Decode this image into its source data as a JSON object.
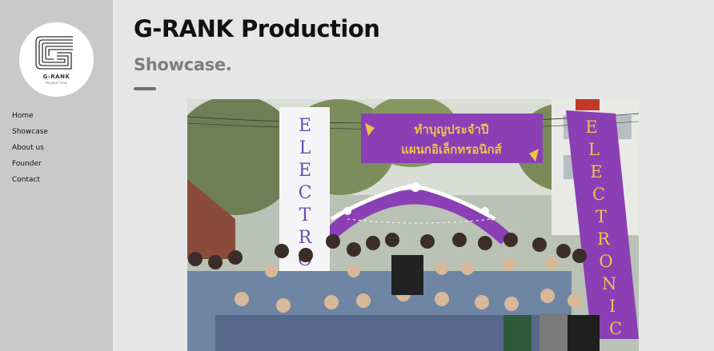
{
  "logo": {
    "name": "G-RANK",
    "tagline": "PRODUCTION"
  },
  "nav": {
    "items": [
      {
        "label": "Home"
      },
      {
        "label": "Showcase"
      },
      {
        "label": "About us"
      },
      {
        "label": "Founder"
      },
      {
        "label": "Contact"
      }
    ]
  },
  "header": {
    "title": "G-RANK Production",
    "subtitle": "Showcase."
  },
  "photo": {
    "banner_left": [
      "E",
      "L",
      "E",
      "C",
      "T",
      "R",
      "O"
    ],
    "banner_top": [
      "ทำบุญประจำปี",
      "แผนกอิเล็กทรอนิกส์"
    ],
    "banner_right": [
      "E",
      "L",
      "E",
      "C",
      "T",
      "R",
      "O",
      "N",
      "I",
      "C"
    ]
  },
  "colors": {
    "sidebar": "#c9c9c9",
    "page_bg": "#e6e6e6",
    "banner_purple": "#8b3fb5",
    "banner_gold": "#f0c24a",
    "uniform_blue": "#6f85a4"
  }
}
